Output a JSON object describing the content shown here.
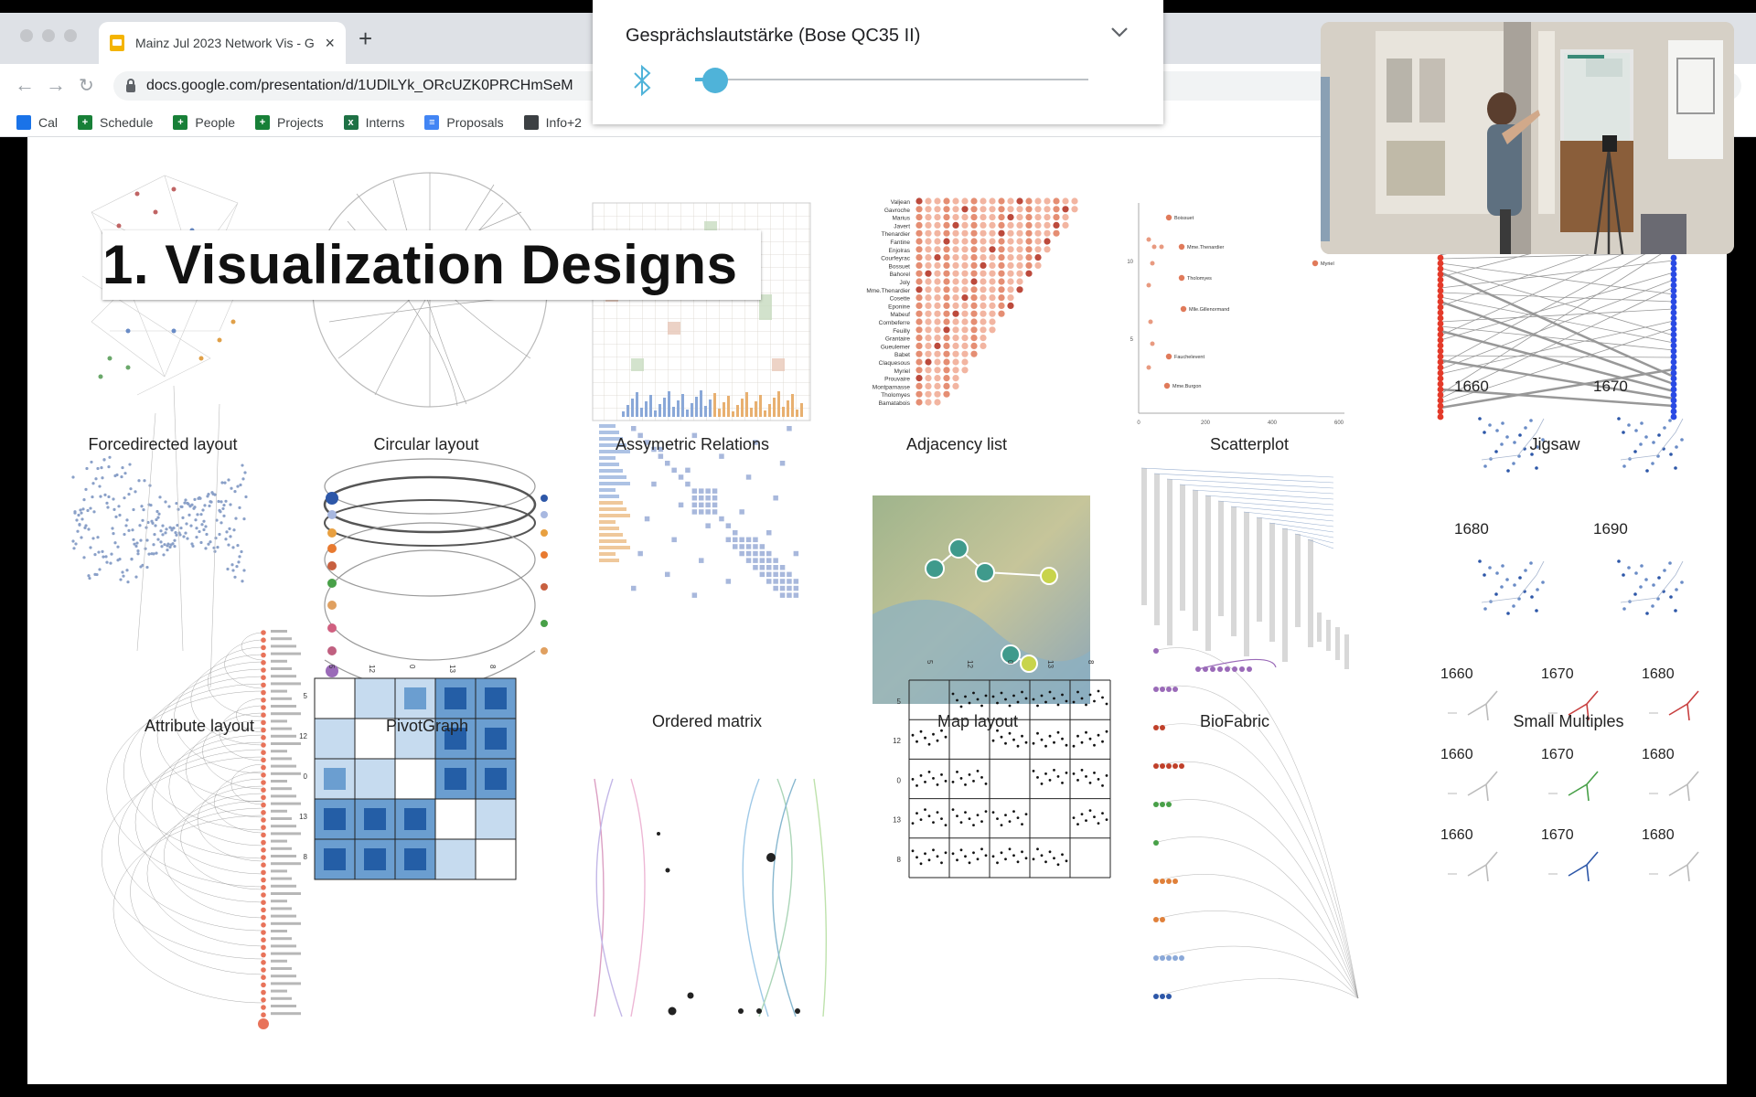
{
  "browser": {
    "tab_title": "Mainz Jul 2023 Network Vis - G",
    "url": "docs.google.com/presentation/d/1UDlLYk_ORcUZK0PRCHmSeM",
    "bookmarks": [
      {
        "label": "Cal",
        "icon": "calendar-icon",
        "color": "#1a73e8"
      },
      {
        "label": "Schedule",
        "icon": "sheets-icon",
        "color": "#188038"
      },
      {
        "label": "People",
        "icon": "sheets-icon",
        "color": "#188038"
      },
      {
        "label": "Projects",
        "icon": "sheets-icon",
        "color": "#188038"
      },
      {
        "label": "Interns",
        "icon": "excel-icon",
        "color": "#1e7145"
      },
      {
        "label": "Proposals",
        "icon": "docs-icon",
        "color": "#4285f4"
      },
      {
        "label": "Info+2",
        "icon": "chair-icon",
        "color": "#3c4043"
      }
    ]
  },
  "volume_popup": {
    "title": "Gesprächslautstärke (Bose QC35 II)",
    "level": 0.05,
    "accent": "#4fb3d9"
  },
  "slide": {
    "title": "1. Visualization Designs",
    "captions": [
      "Forcedirected layout",
      "Circular layout",
      "Assymetric Relations",
      "Adjacency list",
      "Scatterplot",
      "Jigsaw",
      "Attribute layout",
      "PivotGraph",
      "Ordered matrix",
      "Map layout",
      "BioFabric",
      "Small Multiples"
    ],
    "adjacency_names": [
      "Valjean",
      "Gavroche",
      "Marius",
      "Javert",
      "Thenardier",
      "Fantine",
      "Enjolras",
      "Courfeyrac",
      "Bossuet",
      "Bahorel",
      "Joly",
      "Mme.Thenardier",
      "Cosette",
      "Eponine",
      "Mabeuf",
      "Combeferre",
      "Feuilly",
      "Grantaire",
      "Gueulemer",
      "Babet",
      "Claquesous",
      "Myriel",
      "Prouvaire",
      "Montparnasse",
      "Tholomyes",
      "Bamatabois"
    ],
    "scatter_labels": [
      "Boissuet",
      "Mme.Thenardier",
      "Tholomyes",
      "Mlle.Gillenormand",
      "Fauchelevent",
      "Mme.Burgon",
      "Myriel"
    ],
    "scatter_ticks_x": [
      "0",
      "200",
      "400",
      "600"
    ],
    "scatter_ticks_y": [
      "10",
      "5"
    ],
    "small_multiple_years": [
      "1660",
      "1670",
      "1680",
      "1690"
    ],
    "small_multiple_grid_years": [
      [
        "1660",
        "1670",
        "1680"
      ],
      [
        "1660",
        "1670",
        "1680"
      ],
      [
        "1660",
        "1670",
        "1680"
      ]
    ],
    "matrix_labels": [
      "5",
      "12",
      "0",
      "13",
      "8"
    ]
  }
}
